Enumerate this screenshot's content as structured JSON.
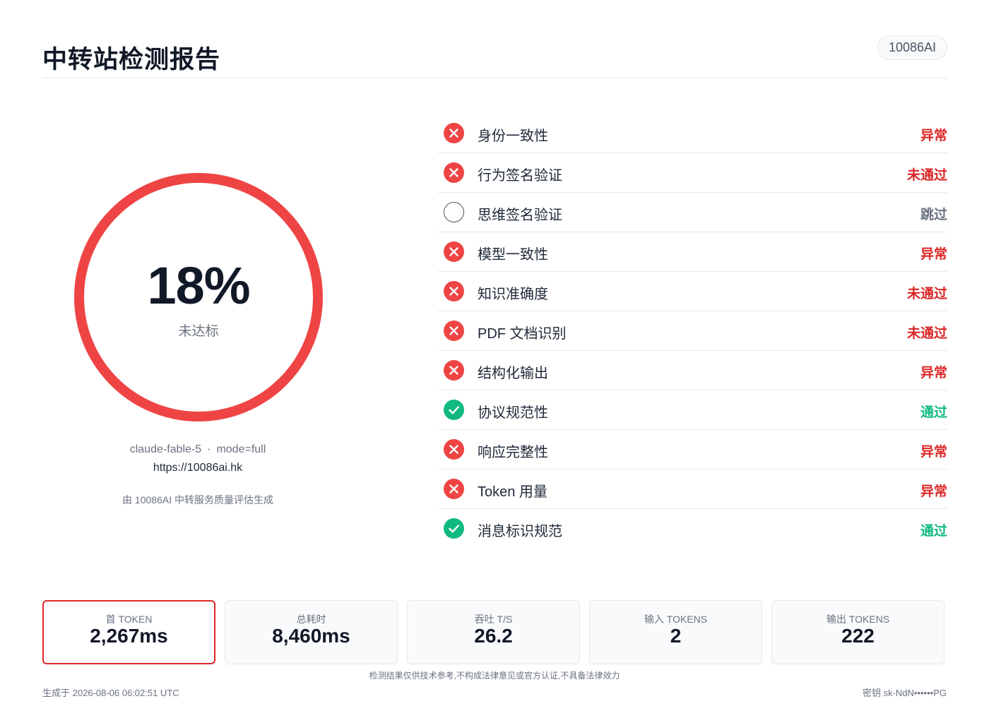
{
  "header": {
    "title": "中转站检测报告",
    "brand": "10086AI"
  },
  "summary": {
    "score": "18%",
    "score_fraction": 0.18,
    "verdict": "未达标",
    "ring_color": "#ef4444",
    "model": "claude-fable-5",
    "separator": "·",
    "mode": "mode=full",
    "url": "https://10086ai.hk",
    "generated_by": "由 10086AI 中转服务质量评估生成"
  },
  "checks": [
    {
      "label": "身份一致性",
      "status": "异常",
      "state": "fail",
      "icon": "x-circle-icon"
    },
    {
      "label": "行为签名验证",
      "status": "未通过",
      "state": "fail",
      "icon": "x-circle-icon"
    },
    {
      "label": "思维签名验证",
      "status": "跳过",
      "state": "skip",
      "icon": "empty-circle-icon"
    },
    {
      "label": "模型一致性",
      "status": "异常",
      "state": "fail",
      "icon": "x-circle-icon"
    },
    {
      "label": "知识准确度",
      "status": "未通过",
      "state": "fail",
      "icon": "x-circle-icon"
    },
    {
      "label": "PDF 文档识别",
      "status": "未通过",
      "state": "fail",
      "icon": "x-circle-icon"
    },
    {
      "label": "结构化输出",
      "status": "异常",
      "state": "fail",
      "icon": "x-circle-icon"
    },
    {
      "label": "协议规范性",
      "status": "通过",
      "state": "pass",
      "icon": "check-circle-icon"
    },
    {
      "label": "响应完整性",
      "status": "异常",
      "state": "fail",
      "icon": "x-circle-icon"
    },
    {
      "label": "Token 用量",
      "status": "异常",
      "state": "fail",
      "icon": "x-circle-icon"
    },
    {
      "label": "消息标识规范",
      "status": "通过",
      "state": "pass",
      "icon": "check-circle-icon"
    }
  ],
  "metrics": [
    {
      "label": "首 TOKEN",
      "value": "2,267ms",
      "highlight": true
    },
    {
      "label": "总耗时",
      "value": "8,460ms",
      "highlight": false
    },
    {
      "label": "吞吐 T/S",
      "value": "26.2",
      "highlight": false
    },
    {
      "label": "输入 TOKENS",
      "value": "2",
      "highlight": false
    },
    {
      "label": "输出 TOKENS",
      "value": "222",
      "highlight": false
    }
  ],
  "footer": {
    "disclaimer": "检测结果仅供技术参考,不构成法律意见或官方认证,不具备法律效力",
    "generated_at": "生成于 2026-08-06 06:02:51 UTC",
    "key": "密钥 sk-NdN••••••PG"
  },
  "colors": {
    "fail": "#ef4444",
    "pass": "#10b981",
    "skip": "#4b5563"
  }
}
